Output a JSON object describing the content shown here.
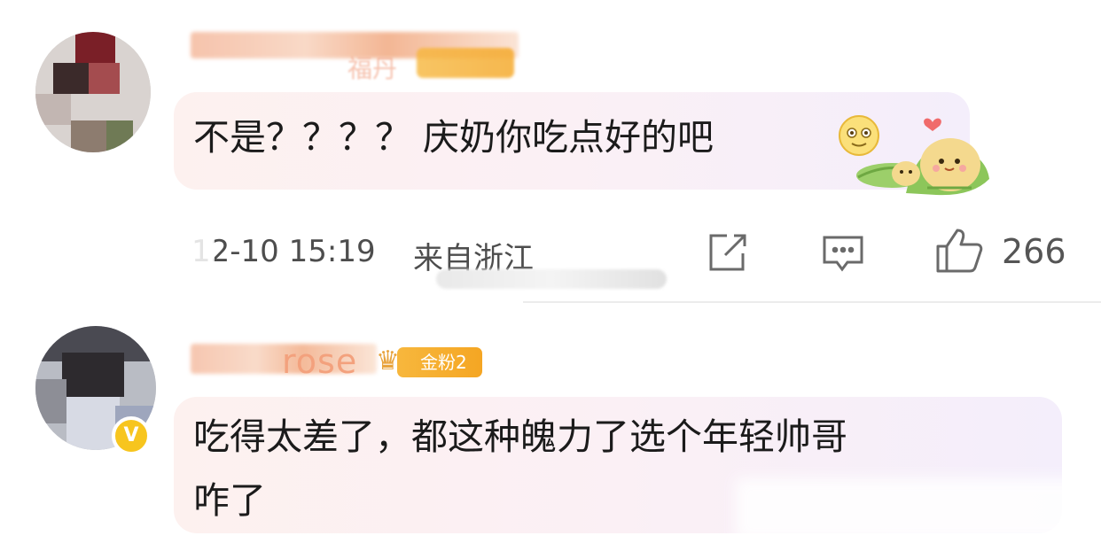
{
  "comments": [
    {
      "username_visible": "福丹",
      "text": "不是？？？？ 庆奶你吃点好的吧",
      "timestamp": "12-10 15:19",
      "location": "来自浙江",
      "likes": "266",
      "emoji_1": "face-icon",
      "emoji_2": "zongzi-sticker"
    },
    {
      "username_visible": "rose",
      "badge_text": "金粉2",
      "text_line1": "吃得太差了，都这种魄力了选个年轻帅哥",
      "text_line2": "咋了"
    }
  ],
  "colors": {
    "badge": "#f5a623",
    "bubble": "#fbf0f5",
    "vip": "#f7c51e"
  }
}
